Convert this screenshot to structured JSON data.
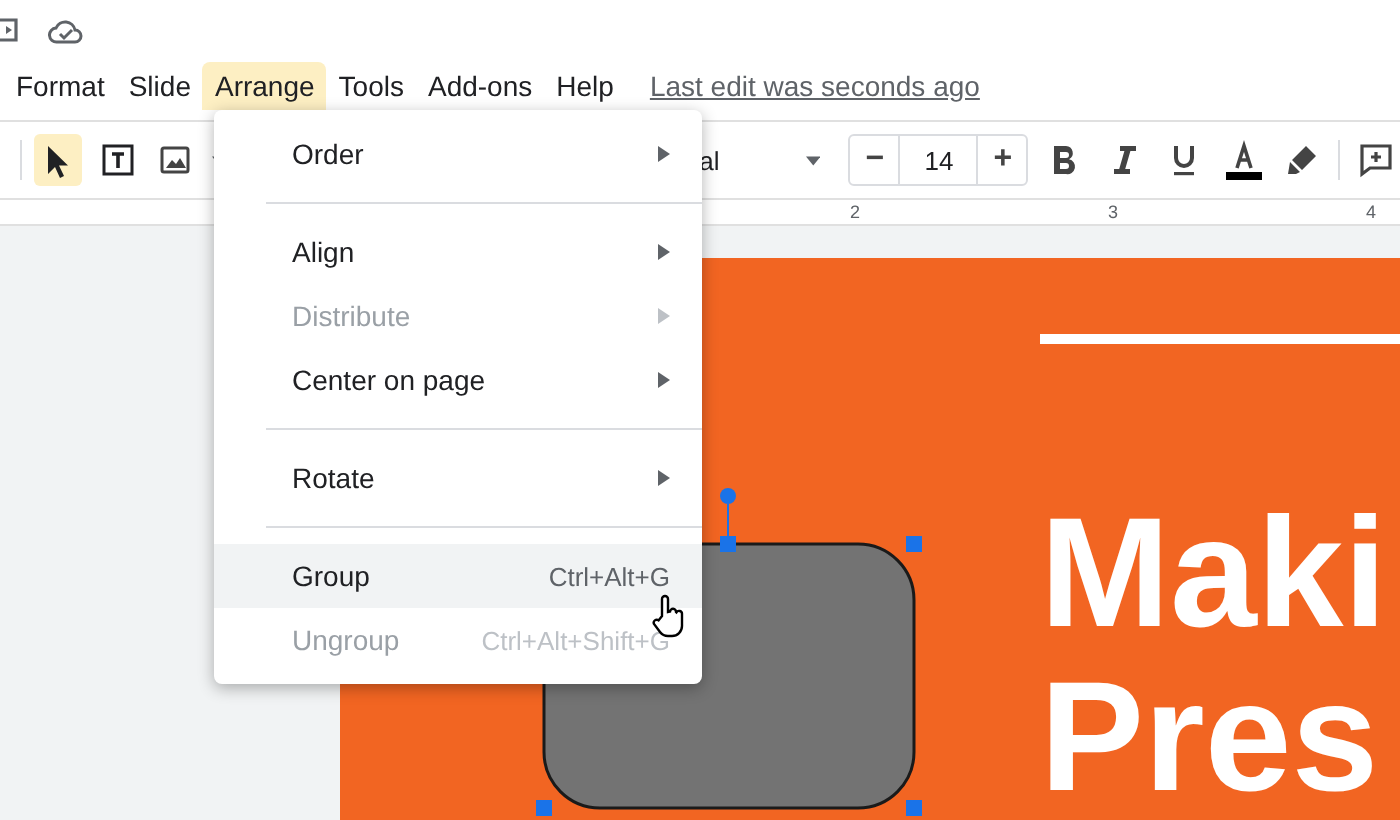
{
  "menu_bar": {
    "items": [
      {
        "label": "Format",
        "selected": false
      },
      {
        "label": "Slide",
        "selected": false
      },
      {
        "label": "Arrange",
        "selected": true
      },
      {
        "label": "Tools",
        "selected": false
      },
      {
        "label": "Add-ons",
        "selected": false
      },
      {
        "label": "Help",
        "selected": false
      }
    ],
    "last_edit": "Last edit was seconds ago"
  },
  "toolbar": {
    "tools": [
      {
        "kind": "pointer",
        "selected": true
      },
      {
        "kind": "textbox",
        "selected": false
      },
      {
        "kind": "image",
        "selected": false
      }
    ],
    "font": "al",
    "font_size": "14",
    "size_minus": "−",
    "size_plus": "+"
  },
  "ruler": {
    "labels": [
      "2",
      "3",
      "4"
    ]
  },
  "arrange_menu": {
    "items": [
      {
        "kind": "item",
        "label": "Order",
        "has_submenu": true,
        "disabled": false,
        "highlighted": false
      },
      {
        "kind": "divider"
      },
      {
        "kind": "item",
        "label": "Align",
        "has_submenu": true,
        "disabled": false,
        "highlighted": false
      },
      {
        "kind": "item",
        "label": "Distribute",
        "has_submenu": true,
        "disabled": true,
        "highlighted": false
      },
      {
        "kind": "item",
        "label": "Center on page",
        "has_submenu": true,
        "disabled": false,
        "highlighted": false
      },
      {
        "kind": "divider"
      },
      {
        "kind": "item",
        "label": "Rotate",
        "has_submenu": true,
        "disabled": false,
        "highlighted": false
      },
      {
        "kind": "divider"
      },
      {
        "kind": "item",
        "label": "Group",
        "shortcut": "Ctrl+Alt+G",
        "disabled": false,
        "highlighted": true
      },
      {
        "kind": "item",
        "label": "Ungroup",
        "shortcut": "Ctrl+Alt+Shift+G",
        "disabled": true,
        "highlighted": false
      }
    ]
  },
  "slide": {
    "title_lines": [
      "Maki",
      "Pres"
    ]
  }
}
